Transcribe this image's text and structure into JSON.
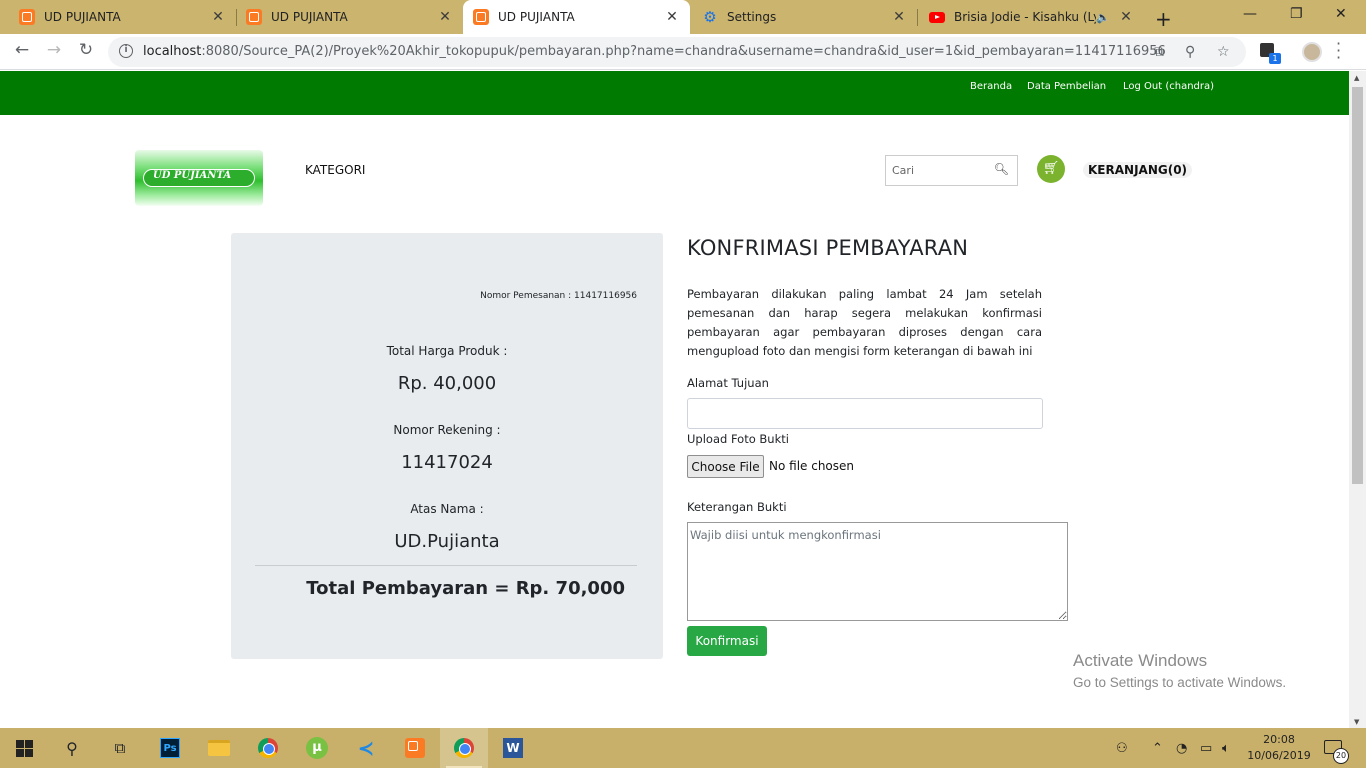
{
  "browser": {
    "tabs": [
      {
        "title": "UD PUJIANTA",
        "icon": "xampp-icon",
        "active": false
      },
      {
        "title": "UD PUJIANTA",
        "icon": "xampp-icon",
        "active": false
      },
      {
        "title": "UD PUJIANTA",
        "icon": "xampp-icon",
        "active": true
      },
      {
        "title": "Settings",
        "icon": "gear-icon",
        "active": false
      },
      {
        "title": "Brisia Jodie - Kisahku (Lyric",
        "icon": "youtube-icon",
        "active": false
      }
    ],
    "close_glyph": "✕",
    "new_tab_glyph": "+",
    "url_host": "localhost",
    "url_rest": ":8080/Source_PA(2)/Proyek%20Akhir_tokopupuk/pembayaran.php?name=chandra&username=chandra&id_user=1&id_pembayaran=11417116956",
    "extension_badge": "1"
  },
  "topnav": {
    "items": [
      "Beranda",
      "Data Pembelian",
      "Log Out (chandra)"
    ]
  },
  "header": {
    "logo_text": "UD PUJIANTA",
    "kategori": "KATEGORI",
    "search_placeholder": "Cari",
    "cart_label": "KERANJANG(0)"
  },
  "payment": {
    "order_label": "Nomor Pemesanan : 11417116956",
    "total_harga_label": "Total Harga Produk :",
    "total_harga_value": "Rp. 40,000",
    "rekening_label": "Nomor Rekening :",
    "rekening_value": "11417024",
    "atas_nama_label": "Atas Nama :",
    "atas_nama_value": "UD.Pujianta",
    "total_pembayaran": "Total Pembayaran = Rp. 70,000"
  },
  "form": {
    "title": "KONFRIMASI PEMBAYARAN",
    "description": "Pembayaran dilakukan paling lambat 24 Jam setelah pemesanan dan harap segera melakukan konfirmasi pembayaran agar pembayaran diproses dengan cara mengupload foto dan mengisi form keterangan di bawah ini",
    "alamat_label": "Alamat Tujuan",
    "alamat_value": "",
    "upload_label": "Upload Foto Bukti",
    "choose_file": "Choose File",
    "no_file": "No file chosen",
    "keterangan_label": "Keterangan Bukti",
    "keterangan_placeholder": "Wajib diisi untuk mengkonfirmasi",
    "submit": "Konfirmasi"
  },
  "watermark": {
    "line1": "Activate Windows",
    "line2": "Go to Settings to activate Windows."
  },
  "taskbar": {
    "apps": [
      "windows-start",
      "search",
      "task-view",
      "photoshop",
      "file-explorer",
      "chrome",
      "utorrent",
      "vscode",
      "xampp",
      "chrome-active",
      "word"
    ],
    "ps_label": "Ps",
    "word_label": "W",
    "time": "20:08",
    "date": "10/06/2019",
    "notifications": "20"
  },
  "colors": {
    "nav_green": "#007a00",
    "button_green": "#28a745",
    "card_gray": "#e9ecef",
    "tab_strip": "#cbb46e"
  }
}
